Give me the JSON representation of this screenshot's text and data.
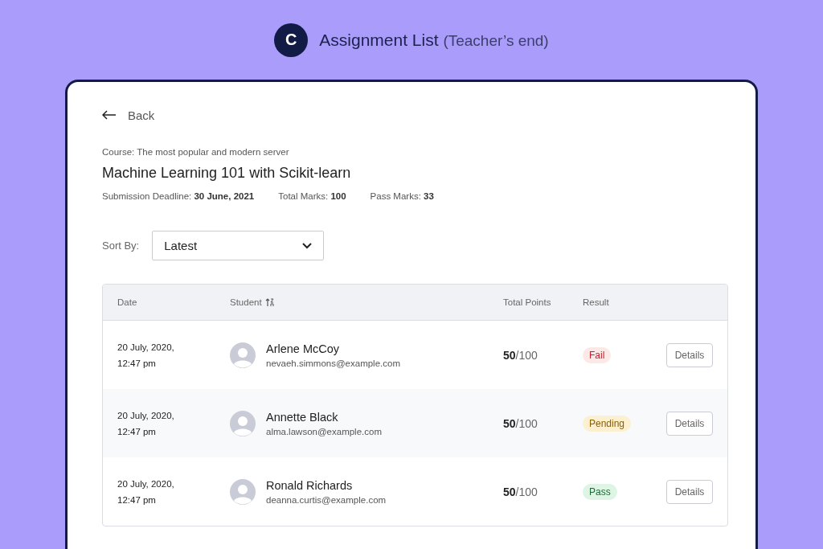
{
  "header": {
    "logo_letter": "C",
    "title": "Assignment List",
    "subtitle": "(Teacher’s end)"
  },
  "back": {
    "label": "Back"
  },
  "course": {
    "caption": "Course: The most popular and modern server",
    "title": "Machine Learning 101 with Scikit-learn",
    "meta": [
      {
        "label": "Submission Deadline:",
        "value": "30 June, 2021"
      },
      {
        "label": "Total Marks:",
        "value": "100"
      },
      {
        "label": "Pass Marks:",
        "value": "33"
      }
    ]
  },
  "sort": {
    "label": "Sort By:",
    "value": "Latest"
  },
  "table": {
    "columns": [
      {
        "label": "Date",
        "sortable": false
      },
      {
        "label": "Student",
        "sortable": true
      },
      {
        "label": "Total Points",
        "sortable": false
      },
      {
        "label": "Result",
        "sortable": false
      }
    ],
    "rows": [
      {
        "date": "20 July, 2020,",
        "time": "12:47 pm",
        "name": "Arlene McCoy",
        "email": "nevaeh.simmons@example.com",
        "score": "50",
        "total": "/100",
        "result": {
          "label": "Fail",
          "kind": "fail"
        },
        "action": "Details"
      },
      {
        "date": "20 July, 2020,",
        "time": "12:47 pm",
        "name": "Annette Black",
        "email": "alma.lawson@example.com",
        "score": "50",
        "total": "/100",
        "result": {
          "label": "Pending",
          "kind": "pending"
        },
        "action": "Details"
      },
      {
        "date": "20 July, 2020,",
        "time": "12:47 pm",
        "name": "Ronald Richards",
        "email": "deanna.curtis@example.com",
        "score": "50",
        "total": "/100",
        "result": {
          "label": "Pass",
          "kind": "pass"
        },
        "action": "Details"
      }
    ]
  }
}
